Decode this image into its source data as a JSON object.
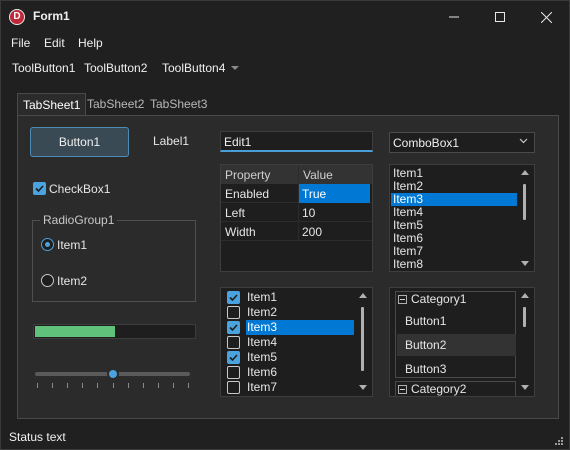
{
  "window": {
    "app_icon_letter": "D",
    "title": "Form1",
    "buttons": [
      "minimize",
      "maximize",
      "close"
    ]
  },
  "menu": [
    "File",
    "Edit",
    "Help"
  ],
  "toolbar": {
    "buttons": [
      "ToolButton1",
      "ToolButton2",
      "ToolButton4"
    ]
  },
  "tabs": {
    "items": [
      "TabSheet1",
      "TabSheet2",
      "TabSheet3"
    ],
    "active": "TabSheet1"
  },
  "controls": {
    "button1": "Button1",
    "label1": "Label1",
    "edit1": "Edit1",
    "combobox1": "ComboBox1",
    "checkbox1": {
      "label": "CheckBox1",
      "checked": true
    },
    "radiogroup": {
      "title": "RadioGroup1",
      "items": [
        "Item1",
        "Item2"
      ],
      "selected": "Item1"
    },
    "progress": {
      "value_percent": 50
    },
    "slider": {
      "min": 0,
      "max": 10,
      "position": 5
    }
  },
  "value_grid": {
    "headers": [
      "Property",
      "Value"
    ],
    "rows": [
      [
        "Enabled",
        "True"
      ],
      [
        "Left",
        "10"
      ],
      [
        "Width",
        "200"
      ]
    ],
    "selected_cell": "True"
  },
  "listbox": {
    "items": [
      "Item1",
      "Item2",
      "Item3",
      "Item4",
      "Item5",
      "Item6",
      "Item7",
      "Item8"
    ],
    "selected": "Item3"
  },
  "checklist": {
    "items": [
      {
        "label": "Item1",
        "checked": true
      },
      {
        "label": "Item2",
        "checked": false
      },
      {
        "label": "Item3",
        "checked": true
      },
      {
        "label": "Item4",
        "checked": false
      },
      {
        "label": "Item5",
        "checked": true
      },
      {
        "label": "Item6",
        "checked": false
      },
      {
        "label": "Item7",
        "checked": false
      }
    ],
    "selected": "Item3"
  },
  "category_panel": {
    "categories": [
      {
        "title": "Category1",
        "buttons": [
          "Button1",
          "Button2",
          "Button3"
        ],
        "hover": "Button2"
      },
      {
        "title": "Category2",
        "buttons": []
      }
    ]
  },
  "status": {
    "text": "Status text"
  },
  "colors": {
    "accent": "#0078d4",
    "check_accent": "#4aa3df",
    "progress_fill": "#5fc17a",
    "background": "#202020",
    "panel": "#2b2b2b"
  }
}
